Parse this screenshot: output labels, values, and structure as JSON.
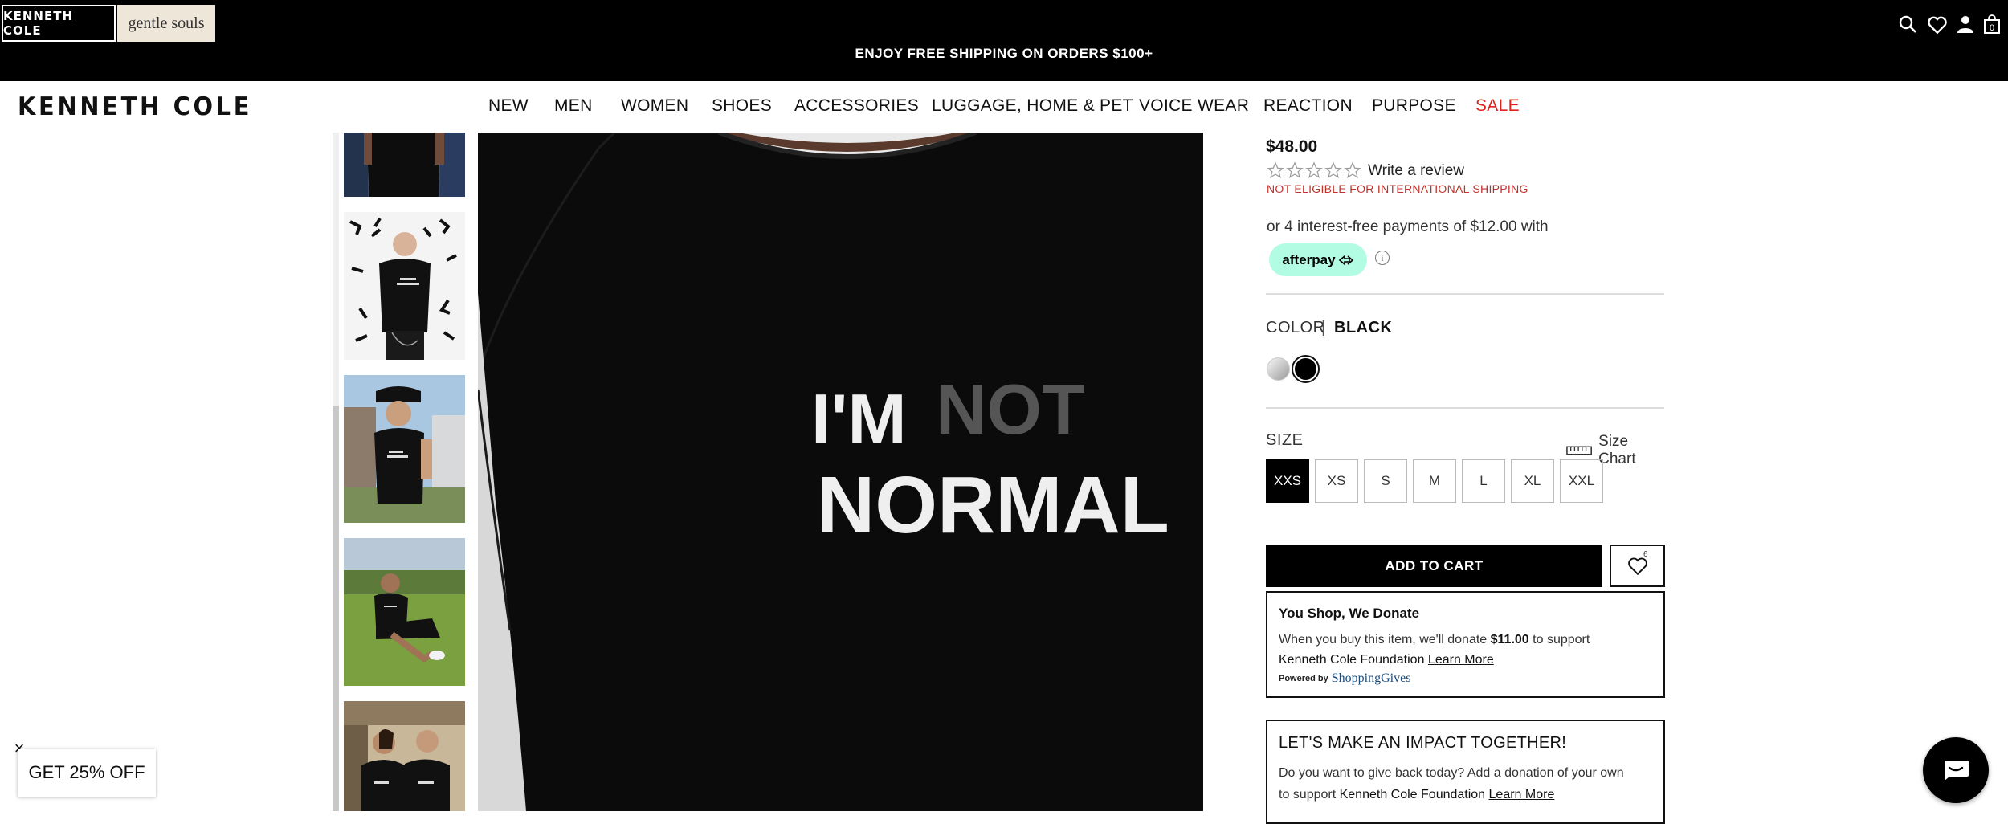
{
  "topbar": {
    "brand_tabs": [
      "KENNETH COLE",
      "gentle souls"
    ],
    "promo": "ENJOY FREE SHIPPING ON ORDERS $100+",
    "cart_count": "0",
    "icons": [
      "search-icon",
      "heart-icon",
      "user-icon",
      "cart-icon"
    ]
  },
  "header": {
    "logo": "KENNETH COLE",
    "nav": [
      {
        "label": "NEW"
      },
      {
        "label": "MEN"
      },
      {
        "label": "WOMEN"
      },
      {
        "label": "SHOES"
      },
      {
        "label": "ACCESSORIES"
      },
      {
        "label": "LUGGAGE, HOME & PET"
      },
      {
        "label": "VOICE WEAR"
      },
      {
        "label": "REACTION"
      },
      {
        "label": "PURPOSE"
      },
      {
        "label": "SALE"
      }
    ]
  },
  "gallery": {
    "main_image_text": [
      "I'M",
      "NOT",
      "NORMAL"
    ],
    "thumbnail_count": 5
  },
  "product": {
    "price": "$48.00",
    "rating": 0,
    "review_link": "Write a review",
    "shipping_note": "NOT ELIGIBLE FOR INTERNATIONAL SHIPPING",
    "installment": "or 4 interest-free payments of $12.00 with",
    "afterpay_label": "afterpay",
    "color_label": "COLOR",
    "color_separator": "|",
    "color_value": "BLACK",
    "swatches": [
      "silver",
      "black"
    ],
    "size_label": "SIZE",
    "size_chart_label": "Size Chart",
    "sizes": [
      "XXS",
      "XS",
      "S",
      "M",
      "L",
      "XL",
      "XXL"
    ],
    "selected_size": "XXS",
    "add_to_cart": "ADD TO CART",
    "wishlist_count": "6"
  },
  "donate": {
    "title": "You Shop, We Donate",
    "text_1": "When you buy this item, we'll donate",
    "amount": "$11.00",
    "text_2": "to support",
    "foundation": "Kenneth Cole Foundation",
    "learn_more": "Learn More",
    "powered_by": "Powered by",
    "provider": "ShoppingGives"
  },
  "impact": {
    "title": "LET'S MAKE AN IMPACT TOGETHER!",
    "text_1": "Do you want to give back today? Add a donation of your own",
    "text_2": "to support",
    "foundation": "Kenneth Cole Foundation",
    "learn_more": "Learn More"
  },
  "popup": {
    "label": "GET 25% OFF",
    "close": "×"
  },
  "colors": {
    "sale": "#e0211d",
    "afterpay": "#b2fce4",
    "warning": "#c0312c"
  }
}
